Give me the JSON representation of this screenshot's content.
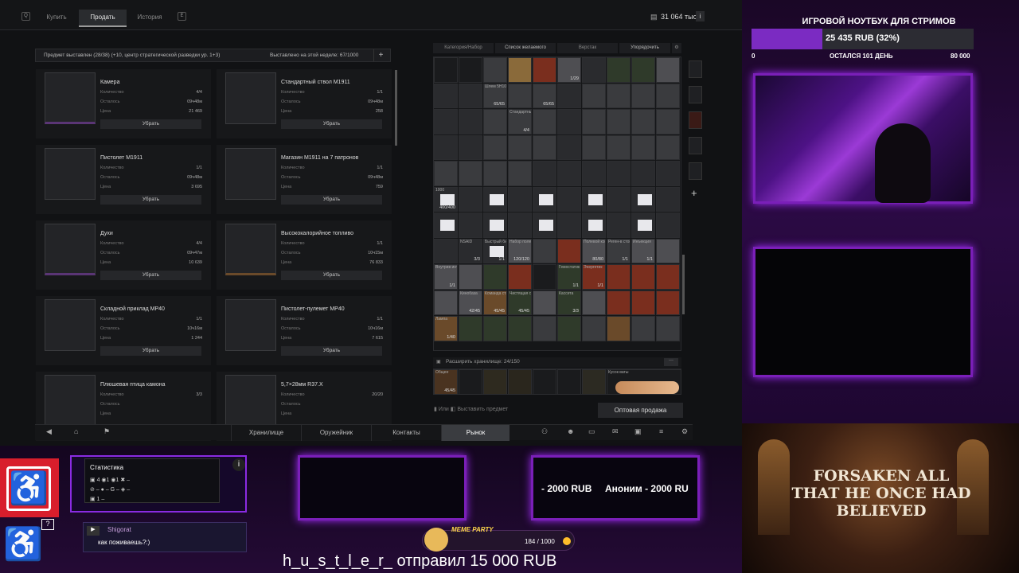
{
  "topbar": {
    "tabs": [
      {
        "label": "Купить"
      },
      {
        "label": "Продать"
      },
      {
        "label": "История"
      }
    ],
    "keys": {
      "left": "Q",
      "right": "E"
    },
    "balance": "31 064 тыс."
  },
  "listing_bar": {
    "left": "Предмет выставлен (28/38)   (+10, центр стратегической разведки ур. 1+3)",
    "right": "Выставлено на этой неделе: 67/1000",
    "add": "+"
  },
  "labels": {
    "qty": "Количество",
    "left": "Осталось",
    "price": "Цена",
    "remove": "Убрать"
  },
  "listings": [
    {
      "name": "Камера",
      "qty": "4/4",
      "time": "09ч48м",
      "price": "21 469"
    },
    {
      "name": "Стандартный ствол M1911",
      "qty": "1/1",
      "time": "09ч48м",
      "price": "258"
    },
    {
      "name": "Пистолет M1911",
      "qty": "1/1",
      "time": "09ч48м",
      "price": "3 695"
    },
    {
      "name": "Магазин M1911 на 7 патронов",
      "qty": "1/1",
      "time": "09ч48м",
      "price": "759"
    },
    {
      "name": "Духи",
      "qty": "4/4",
      "time": "09ч47м",
      "price": "10 639"
    },
    {
      "name": "Высококалорийное топливо",
      "qty": "1/1",
      "time": "10ч15м",
      "price": "76 833"
    },
    {
      "name": "Складной приклад MP40",
      "qty": "1/1",
      "time": "10ч16м",
      "price": "1 244"
    },
    {
      "name": "Пистолет-пулемет MP40",
      "qty": "1/1",
      "time": "10ч16м",
      "price": "7 615"
    },
    {
      "name": "Плюшевая птица камона",
      "qty": "3/3",
      "time": "",
      "price": ""
    },
    {
      "name": "5,7×28мм R37.X",
      "qty": "20/20",
      "time": "",
      "price": ""
    }
  ],
  "stash_filters": {
    "a": "Категория/Набор",
    "b": "Список желаемого",
    "c": "Верстак",
    "d": "Упорядочить"
  },
  "stash_cells": [
    {
      "label": "",
      "count": "1/29"
    },
    {
      "label": "Шлем 5H10Л",
      "count": "65/65"
    },
    {
      "label": "",
      "count": "65/65"
    },
    {
      "label": "Стандартный набор",
      "count": "4/4"
    },
    {
      "label": "1000",
      "count": "400/400"
    },
    {
      "label": "NSAID",
      "count": "3/3"
    },
    {
      "label": "Быстрый бинт",
      "count": "1/1"
    },
    {
      "label": "Набор полевой",
      "count": "120/120"
    },
    {
      "label": "Полевой комплект",
      "count": "80/80"
    },
    {
      "label": "Реген-в стойк",
      "count": "1/1"
    },
    {
      "label": "Инъекция",
      "count": "1/1"
    },
    {
      "label": "Внутрив инъекция",
      "count": "1/1"
    },
    {
      "label": "Гемостатик",
      "count": "1/1"
    },
    {
      "label": "Энергетик",
      "count": "1/1"
    },
    {
      "label": "Кинобаза",
      "count": "42/45"
    },
    {
      "label": "Команда станка",
      "count": "45/45"
    },
    {
      "label": "Чистящая станция",
      "count": "45/45"
    },
    {
      "label": "Кассета",
      "count": "3/3"
    },
    {
      "label": "Лампа",
      "count": "1/40"
    }
  ],
  "stash_expand": "Расширить хранилище: 24/150",
  "bottom_stash": {
    "first": "Общее",
    "first_count": "45/45",
    "last": "Кусок ваты"
  },
  "hint": {
    "or": "Или",
    "action": "Выставить предмет"
  },
  "wholesale": "Оптовая продажа",
  "nav": [
    {
      "label": "Хранилище"
    },
    {
      "label": "Оружейник"
    },
    {
      "label": "Контакты"
    },
    {
      "label": "Рынок"
    }
  ],
  "stream_goal": {
    "title": "ИГРОВОЙ НОУТБУК ДЛЯ СТРИМОВ",
    "amount": "25 435 RUB (32%)",
    "progress": 0.32,
    "min": "0",
    "remaining": "ОСТАЛСЯ 101 ДЕНЬ",
    "max": "80 000"
  },
  "stats": {
    "title": "Статистика",
    "info": "i",
    "row1": [
      "4",
      "1",
      "1"
    ],
    "chat_user": "Shigorat",
    "chat_msg": "как поживаешь?:)"
  },
  "donations": {
    "a": "- 2000 RUB",
    "b": "Аноним - 2000 RU"
  },
  "meme": {
    "label": "MEME PARTY",
    "count": "184 / 1000"
  },
  "ticker": "h_u_s_t_l_e_r_ отправил 15 000 RUB",
  "forsaken": "FORSAKEN ALL THAT HE ONCE HAD BELIEVED",
  "colors": {
    "accent": "#8a2be2",
    "bar": "#7b2bc2",
    "wheelchair": "#d81e2c"
  }
}
